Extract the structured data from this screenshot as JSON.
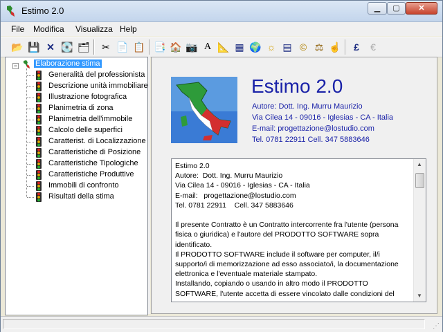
{
  "window": {
    "title": "Estimo 2.0"
  },
  "menu": [
    "File",
    "Modifica",
    "Visualizza",
    "Help"
  ],
  "toolbar": {
    "groups": [
      [
        "open-folder-icon",
        "save-icon",
        "delete-icon",
        "copy-db-icon",
        "export-icon"
      ],
      [
        "cut-icon",
        "copy-icon",
        "paste-icon"
      ],
      [
        "report-icon",
        "house-icon",
        "camera-icon",
        "compass-icon",
        "chart-icon",
        "calculator-icon",
        "globe-icon",
        "sun-icon",
        "grid-icon",
        "coins-icon",
        "scale-icon",
        "hand-icon"
      ],
      [
        "pound-icon",
        "euro-icon"
      ]
    ],
    "glyphs": [
      "📂",
      "💾",
      "✕",
      "💽",
      "🗂",
      "✂",
      "📄",
      "📋",
      "📑",
      "🏠",
      "📷",
      "A",
      "📐",
      "▦",
      "🌍",
      "☼",
      "▤",
      "©",
      "⚖",
      "☝",
      "£",
      "€"
    ]
  },
  "tree": {
    "root": "Elaborazione stima",
    "items": [
      "Generalità del professionista",
      "Descrizione unità immobiliare",
      "Illustrazione fotografica",
      "Planimetria di zona",
      "Planimetria dell'immobile",
      "Calcolo delle superfici",
      "Caratterist. di Localizzazione",
      "Caratteristiche di Posizione",
      "Caratteristiche Tipologiche",
      "Caratteristiche Produttive",
      "Immobili di confronto",
      "Risultati della stima"
    ]
  },
  "about": {
    "app_name": "Estimo 2.0",
    "author": "Autore:  Dott. Ing. Murru Maurizio",
    "address": "Via Cilea 14 - 09016 - Iglesias - CA - Italia",
    "email": "E-mail: progettazione@lostudio.com",
    "phone": "Tel. 0781 22911    Cell. 347 5883646"
  },
  "license": {
    "text": "Estimo 2.0\nAutore:  Dott. Ing. Murru Maurizio\nVia Cilea 14 - 09016 - Iglesias - CA - Italia\nE-mail:   progettazione@lostudio.com\nTel. 0781 22911    Cell. 347 5883646\n\nIl presente Contratto è un Contratto intercorrente fra l'utente (persona fisica o giuridica) e l'autore del PRODOTTO SOFTWARE sopra identificato.\nIl PRODOTTO SOFTWARE include il software per computer, il/i supporto/i di memorizzazione ad esso associato/i, la documentazione elettronica e l'eventuale materiale stampato.\nInstallando, copiando o usando in altro modo il PRODOTTO SOFTWARE, l'utente accetta di essere vincolato dalle condizioni del"
  },
  "colors": {
    "accent": "#1a22a8",
    "selection": "#3399ff"
  }
}
